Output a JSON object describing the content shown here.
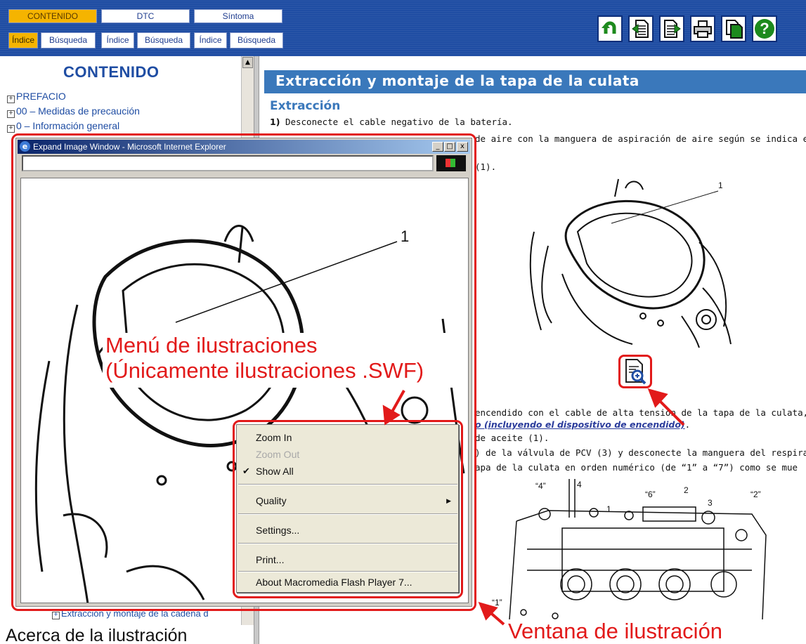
{
  "header": {
    "main_tabs": [
      {
        "label": "CONTENIDO",
        "active": true
      },
      {
        "label": "DTC",
        "active": false
      },
      {
        "label": "Síntoma",
        "active": false
      }
    ],
    "sub_tabs": [
      {
        "label": "Índice",
        "active": true
      },
      {
        "label": "Búsqueda",
        "active": false
      },
      {
        "label": "Índice",
        "active": false
      },
      {
        "label": "Búsqueda",
        "active": false
      },
      {
        "label": "Índice",
        "active": false
      },
      {
        "label": "Búsqueda",
        "active": false
      }
    ],
    "toolbar_icons": [
      "back-icon",
      "previous-page-icon",
      "next-page-icon",
      "print-icon",
      "copy-icon",
      "help-icon"
    ],
    "help_glyph": "?"
  },
  "sidebar": {
    "title": "CONTENIDO",
    "items": [
      {
        "expander": "+",
        "label": "PREFACIO"
      },
      {
        "expander": "+",
        "label": "00 – Medidas de precaución"
      },
      {
        "expander": "+",
        "label": "0 – Información general"
      }
    ],
    "bottom_item": "Extracción y montaje de la cadena d"
  },
  "content": {
    "title": "Extracción y montaje de la tapa de la culata",
    "section": "Extracción",
    "lines": [
      {
        "num": "1)",
        "text": "Desconecte el cable negativo de la batería."
      },
      {
        "num": "",
        "text": "de aire con la manguera de aspiración de aire según se indica en"
      },
      {
        "num": "",
        "text": "(1)."
      },
      {
        "num": "",
        "text": "encendido con el cable de alta tensión de la tapa de la culata, c"
      },
      {
        "num": "",
        "text": "o (incluyendo el dispositivo de encendido)",
        "link": true
      },
      {
        "num": "",
        "text": "de aceite (1)."
      },
      {
        "num": "",
        "text": ") de la válvula de PCV (3) y desconecte la manguera del respira"
      },
      {
        "num": "",
        "text": "apa de la culata en orden numérico (de “1” a “7”) como se mue"
      }
    ],
    "figure1_labels": [
      "1"
    ],
    "figure2_labels": [
      "“4”",
      "4",
      "1",
      "“6”",
      "2",
      "3",
      "“2”",
      "“1”"
    ]
  },
  "popup": {
    "title": "Expand Image Window - Microsoft Internet Explorer",
    "controls": [
      "_",
      "□",
      "x"
    ],
    "figure_label": "1"
  },
  "context_menu": {
    "items": [
      {
        "label": "Zoom In",
        "enabled": true,
        "checked": false
      },
      {
        "label": "Zoom Out",
        "enabled": false,
        "checked": false
      },
      {
        "label": "Show All",
        "enabled": true,
        "checked": true
      },
      {
        "label": "Quality",
        "enabled": true,
        "submenu": true
      },
      {
        "label": "Settings...",
        "enabled": true
      },
      {
        "label": "Print...",
        "enabled": true
      },
      {
        "label": "About Macromedia Flash Player 7...",
        "enabled": true
      }
    ],
    "check_glyph": "✔",
    "submenu_glyph": "▶"
  },
  "annotations": {
    "menu_label_line1": "Menú de ilustraciones",
    "menu_label_line2": "(Únicamente ilustraciones .SWF)",
    "window_label": "Ventana de ilustración",
    "bottom_caption": "Acerca de la ilustración",
    "accent_color": "#e21a1a"
  },
  "colors": {
    "header_blue": "#1f4da3",
    "tab_active": "#f5b400",
    "title_bar": "#3a78bb"
  }
}
